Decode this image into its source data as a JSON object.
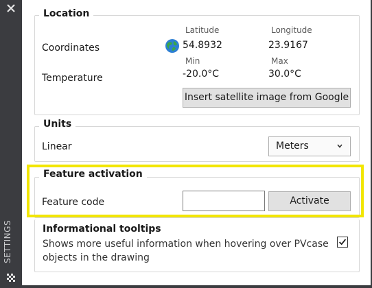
{
  "sidebar": {
    "label": "SETTINGS",
    "close_icon": "close-icon",
    "grid_icon": "grid-icon"
  },
  "location": {
    "title": "Location",
    "coordinates_label": "Coordinates",
    "temperature_label": "Temperature",
    "latitude_label": "Latitude",
    "longitude_label": "Longitude",
    "latitude_value": "54.8932",
    "longitude_value": "23.9167",
    "globe_icon": "globe-icon",
    "min_label": "Min",
    "max_label": "Max",
    "min_value": "-20.0°C",
    "max_value": "30.0°C",
    "satellite_button": "Insert satellite image from Google"
  },
  "units": {
    "title": "Units",
    "linear_label": "Linear",
    "linear_value": "Meters"
  },
  "feature": {
    "title": "Feature activation",
    "code_label": "Feature code",
    "code_value": "",
    "activate_button": "Activate"
  },
  "tooltips": {
    "title": "Informational tooltips",
    "description": "Shows more useful information when hovering over PVcase objects in the drawing",
    "checked": true
  },
  "colors": {
    "highlight": "#f2e600",
    "sidebar": "#3b3c40",
    "button": "#e1e1e1"
  }
}
